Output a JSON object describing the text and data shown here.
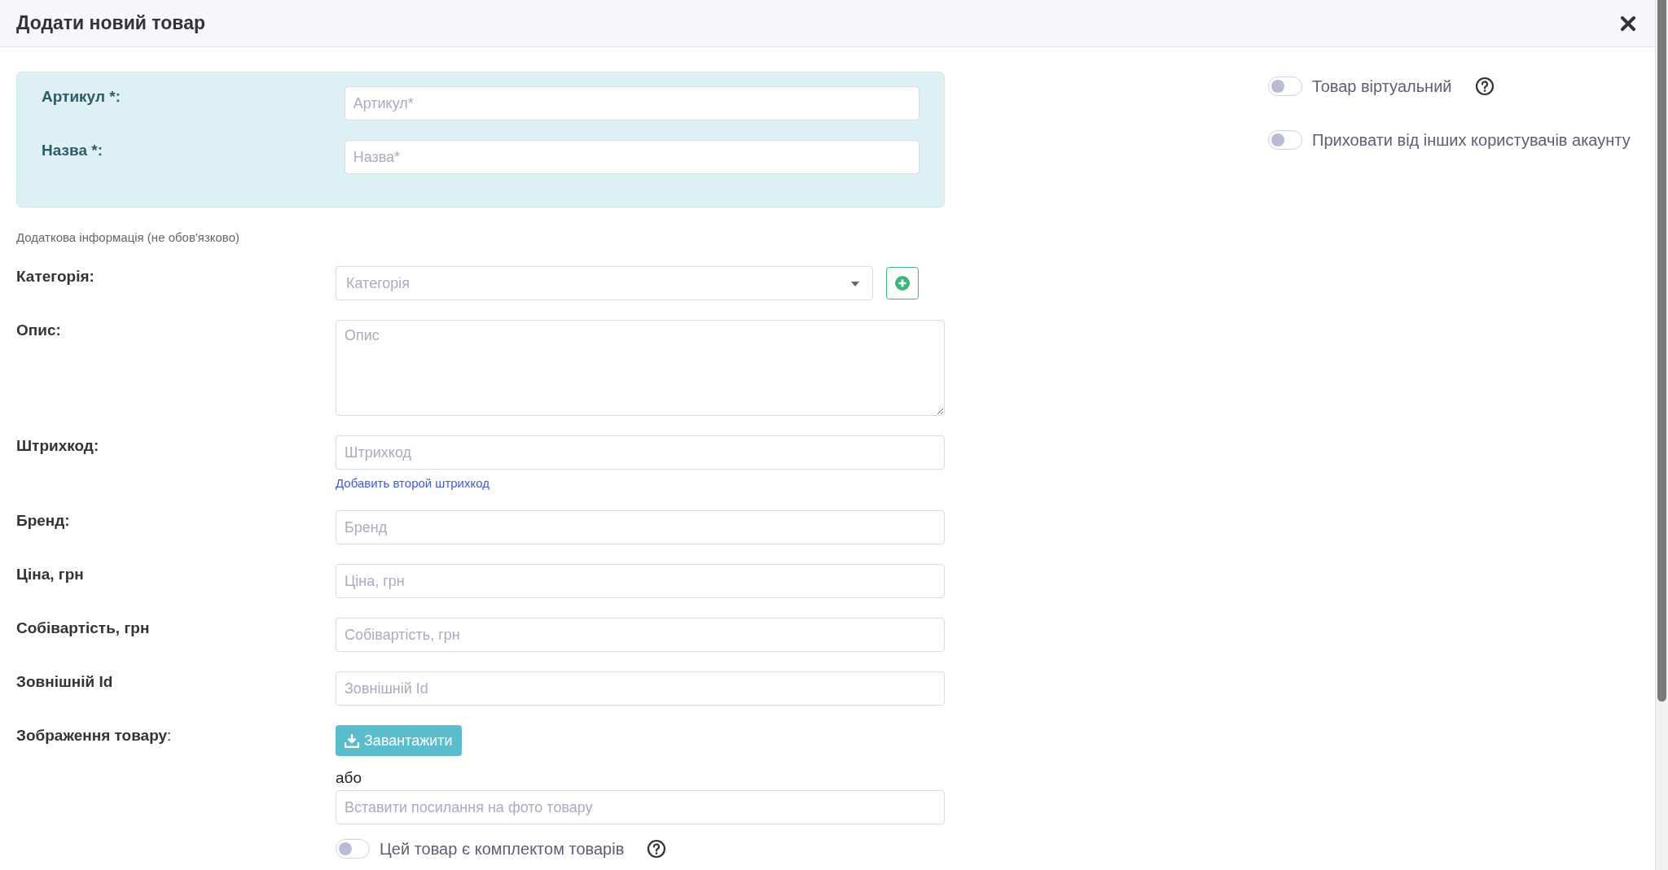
{
  "header": {
    "title": "Додати новий товар"
  },
  "required": [
    {
      "label": "Артикул *:",
      "placeholder": "Артикул*"
    },
    {
      "label": "Назва *:",
      "placeholder": "Назва*"
    }
  ],
  "optional_heading": "Додаткова інформація (не обов'язково)",
  "fields": [
    {
      "kind": "select",
      "label": "Категорія:",
      "placeholder": "Категорія"
    },
    {
      "kind": "textarea",
      "label": "Опис:",
      "placeholder": "Опис"
    },
    {
      "kind": "input",
      "label": "Штрихкод:",
      "placeholder": "Штрихкод",
      "link": "Добавить второй штрихкод"
    },
    {
      "kind": "input",
      "label": "Бренд:",
      "placeholder": "Бренд"
    },
    {
      "kind": "input",
      "label": "Ціна, грн",
      "placeholder": "Ціна, грн"
    },
    {
      "kind": "input",
      "label": "Собівартість, грн",
      "placeholder": "Собівартість, грн"
    },
    {
      "kind": "input",
      "label": "Зовнішній Id",
      "placeholder": "Зовнішній Id"
    },
    {
      "kind": "upload",
      "label": "**Зображення товару**:",
      "button": "Завантажити",
      "or": "або",
      "placeholder": "Вставити посилання на фото товару"
    }
  ],
  "bundle_toggle": {
    "label": "Цей товар є комплектом товарів",
    "on": false,
    "help": true
  },
  "side_toggles": [
    {
      "label": "Товар віртуальний",
      "on": false,
      "help": true
    },
    {
      "label": "Приховати від інших користувачів акаунту",
      "on": false,
      "help": false
    }
  ]
}
